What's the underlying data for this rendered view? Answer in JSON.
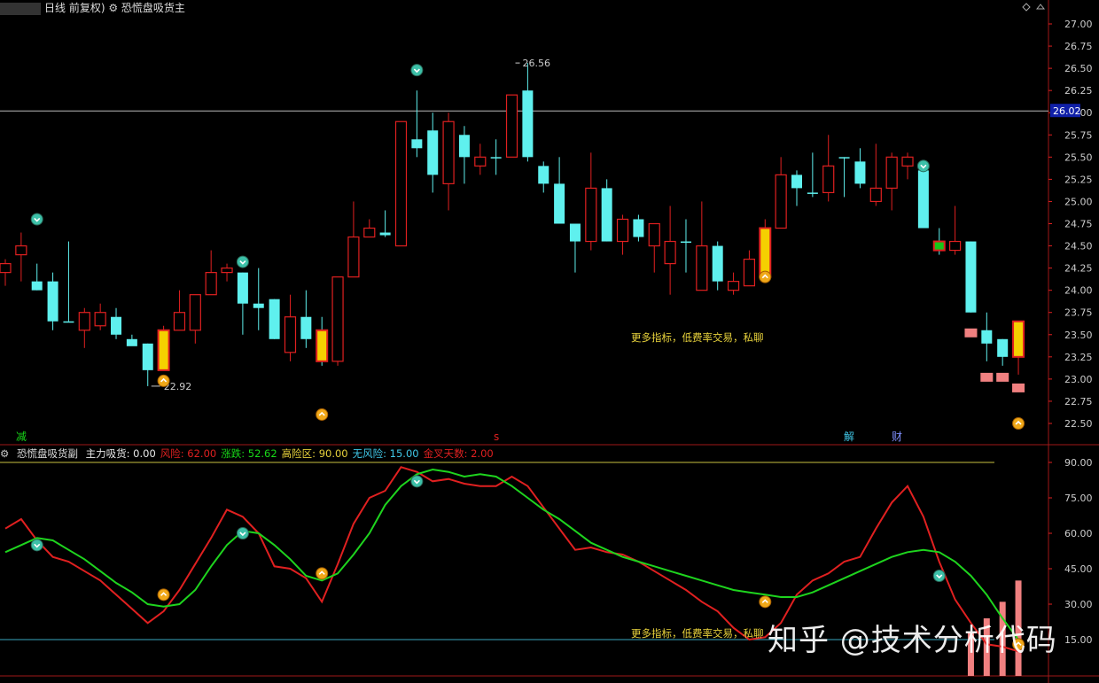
{
  "header": {
    "title_prefix": "日线 前复权)",
    "indicator_main": "恐慌盘吸货主",
    "current_price_badge": "26.02"
  },
  "subheader": {
    "indicator_sub": "恐慌盘吸货副",
    "fields": [
      {
        "label": "主力吸货:",
        "value": "0.00",
        "color": "#e8e8e8"
      },
      {
        "label": "风险:",
        "value": "62.00",
        "color": "#e02020"
      },
      {
        "label": "涨跌:",
        "value": "52.62",
        "color": "#18d818"
      },
      {
        "label": "高险区:",
        "value": "90.00",
        "color": "#e8d23c"
      },
      {
        "label": "无风险:",
        "value": "15.00",
        "color": "#40c8e8"
      },
      {
        "label": "金叉天数:",
        "value": "2.00",
        "color": "#e02020"
      }
    ]
  },
  "promo_text": "更多指标，低费率交易，私聊",
  "watermark": "知乎 @技术分析代码",
  "event_labels": [
    {
      "text": "减",
      "color": "#18d818"
    },
    {
      "text": "s",
      "color": "#e02020"
    },
    {
      "text": "解",
      "color": "#40c8e8"
    },
    {
      "text": "财",
      "color": "#8090ff"
    }
  ],
  "chart_data": [
    {
      "type": "candlestick",
      "title": "",
      "ylim": [
        22.35,
        27.1
      ],
      "y_ticks": [
        "27.00",
        "26.75",
        "26.50",
        "26.25",
        "26.00",
        "25.75",
        "25.50",
        "25.25",
        "25.00",
        "24.75",
        "24.50",
        "24.25",
        "24.00",
        "23.75",
        "23.50",
        "23.25",
        "23.00",
        "22.75",
        "22.50"
      ],
      "high_label": "26.56",
      "low_label": "22.92",
      "reference_line": 26.02,
      "candles": [
        [
          24.2,
          24.3,
          24.35,
          24.05
        ],
        [
          24.4,
          24.5,
          24.65,
          24.1
        ],
        [
          24.1,
          24.0,
          24.3,
          24.0
        ],
        [
          24.1,
          23.65,
          24.2,
          23.55
        ],
        [
          23.65,
          23.65,
          24.55,
          23.65
        ],
        [
          23.55,
          23.75,
          23.8,
          23.35
        ],
        [
          23.6,
          23.75,
          23.85,
          23.55
        ],
        [
          23.7,
          23.5,
          23.8,
          23.45
        ],
        [
          23.45,
          23.37,
          23.5,
          23.4
        ],
        [
          23.4,
          23.1,
          23.4,
          22.92
        ],
        [
          23.1,
          23.55,
          23.6,
          23.1
        ],
        [
          23.55,
          23.75,
          24.0,
          23.55
        ],
        [
          23.55,
          23.95,
          23.95,
          23.4
        ],
        [
          23.95,
          24.2,
          24.45,
          23.95
        ],
        [
          24.2,
          24.25,
          24.3,
          24.1
        ],
        [
          24.2,
          23.85,
          24.2,
          23.5
        ],
        [
          23.85,
          23.8,
          24.25,
          23.55
        ],
        [
          23.9,
          23.45,
          23.9,
          23.45
        ],
        [
          23.3,
          23.7,
          23.95,
          23.2
        ],
        [
          23.7,
          23.45,
          24.0,
          23.35
        ],
        [
          23.55,
          23.2,
          23.7,
          23.15
        ],
        [
          23.2,
          24.15,
          24.15,
          23.15
        ],
        [
          24.15,
          24.6,
          25.0,
          24.15
        ],
        [
          24.6,
          24.7,
          24.8,
          24.6
        ],
        [
          24.65,
          24.62,
          24.9,
          24.6
        ],
        [
          24.5,
          25.9,
          25.9,
          24.5
        ],
        [
          25.7,
          25.6,
          26.25,
          25.5
        ],
        [
          25.8,
          25.3,
          26.0,
          25.1
        ],
        [
          25.2,
          25.9,
          26.0,
          24.9
        ],
        [
          25.75,
          25.5,
          25.85,
          25.2
        ],
        [
          25.4,
          25.5,
          25.65,
          25.3
        ],
        [
          25.5,
          25.5,
          25.7,
          25.3
        ],
        [
          25.5,
          26.2,
          26.2,
          25.5
        ],
        [
          26.25,
          25.5,
          26.56,
          25.45
        ],
        [
          25.4,
          25.2,
          25.45,
          25.1
        ],
        [
          25.2,
          24.75,
          25.5,
          24.75
        ],
        [
          24.75,
          24.55,
          24.75,
          24.2
        ],
        [
          24.55,
          25.15,
          25.55,
          24.45
        ],
        [
          25.15,
          24.55,
          25.25,
          24.55
        ],
        [
          24.55,
          24.8,
          24.85,
          24.4
        ],
        [
          24.8,
          24.6,
          24.85,
          24.55
        ],
        [
          24.5,
          24.75,
          24.75,
          24.2
        ],
        [
          24.3,
          24.55,
          24.95,
          23.95
        ],
        [
          24.55,
          24.55,
          24.8,
          24.2
        ],
        [
          24.0,
          24.5,
          25.0,
          24.0
        ],
        [
          24.5,
          24.1,
          24.55,
          24.0
        ],
        [
          24.0,
          24.1,
          24.2,
          23.95
        ],
        [
          24.05,
          24.35,
          24.45,
          24.05
        ],
        [
          24.15,
          24.7,
          24.8,
          24.15
        ],
        [
          24.7,
          25.3,
          25.5,
          24.7
        ],
        [
          25.3,
          25.15,
          25.35,
          24.95
        ],
        [
          25.1,
          25.1,
          25.55,
          25.05
        ],
        [
          25.1,
          25.4,
          25.75,
          25.0
        ],
        [
          25.5,
          25.5,
          25.5,
          25.05
        ],
        [
          25.45,
          25.2,
          25.6,
          25.15
        ],
        [
          25.0,
          25.15,
          25.65,
          24.95
        ],
        [
          25.15,
          25.5,
          25.55,
          24.9
        ],
        [
          25.4,
          25.5,
          25.55,
          25.25
        ],
        [
          25.35,
          24.7,
          25.35,
          24.7
        ],
        [
          24.55,
          24.45,
          24.7,
          24.4
        ],
        [
          24.45,
          24.55,
          24.95,
          24.4
        ],
        [
          24.55,
          23.75,
          24.55,
          23.75
        ],
        [
          23.55,
          23.4,
          23.75,
          23.2
        ],
        [
          23.45,
          23.25,
          23.45,
          23.15
        ],
        [
          23.25,
          23.65,
          23.65,
          23.05
        ]
      ],
      "yellow_bars": [
        10,
        20,
        48,
        64
      ],
      "green_bar": 59,
      "pink_blocks": [
        [
          61,
          23.52
        ],
        [
          62,
          23.02
        ],
        [
          63,
          23.02
        ],
        [
          64,
          22.9
        ]
      ],
      "markers_down_teal": [
        [
          2,
          24.8
        ],
        [
          15,
          24.32
        ],
        [
          26,
          26.48
        ],
        [
          58,
          25.4
        ]
      ],
      "markers_up_orange": [
        [
          10,
          22.98
        ],
        [
          20,
          22.6
        ],
        [
          48,
          24.15
        ],
        [
          64,
          22.5
        ]
      ]
    },
    {
      "type": "line",
      "title": "",
      "ylim": [
        11,
        95
      ],
      "y_ticks": [
        "90.00",
        "75.00",
        "60.00",
        "45.00",
        "30.00",
        "15.00"
      ],
      "reference_lines": [
        {
          "value": 90,
          "color": "#c8c040"
        },
        {
          "value": 15,
          "color": "#3aa8c0"
        }
      ],
      "series": [
        {
          "name": "风险",
          "color": "#e02020",
          "values": [
            62,
            66,
            57,
            50,
            48,
            44,
            40,
            34,
            28,
            22,
            27,
            36,
            47,
            58,
            70,
            67,
            60,
            46,
            45,
            41,
            31,
            47,
            64,
            75,
            78,
            88,
            86,
            82,
            83,
            81,
            80,
            80,
            84,
            80,
            71,
            62,
            53,
            54,
            52,
            51,
            48,
            44,
            40,
            36,
            31,
            27,
            20,
            15,
            16,
            22,
            34,
            40,
            43,
            48,
            50,
            62,
            73,
            80,
            67,
            48,
            32,
            22,
            13,
            12,
            10
          ]
        },
        {
          "name": "涨跌",
          "color": "#1ed41e",
          "values": [
            52,
            55,
            58,
            57,
            53,
            49,
            44,
            39,
            35,
            30,
            29,
            30,
            36,
            46,
            55,
            61,
            60,
            55,
            49,
            42,
            40,
            43,
            51,
            60,
            72,
            80,
            85,
            87,
            86,
            84,
            85,
            84,
            80,
            75,
            70,
            66,
            61,
            56,
            53,
            50,
            48,
            46,
            44,
            42,
            40,
            38,
            36,
            35,
            34,
            33,
            33,
            35,
            38,
            41,
            44,
            47,
            50,
            52,
            53,
            52,
            48,
            42,
            34,
            24,
            15
          ]
        }
      ],
      "bars": {
        "color": "#f08080",
        "values": [
          [
            61,
            18
          ],
          [
            62,
            24
          ],
          [
            63,
            31
          ],
          [
            64,
            40
          ]
        ]
      },
      "markers_down_teal": [
        [
          2,
          55
        ],
        [
          15,
          60
        ],
        [
          26,
          82
        ],
        [
          59,
          42
        ]
      ],
      "markers_up_orange": [
        [
          10,
          34
        ],
        [
          20,
          43
        ],
        [
          48,
          31
        ],
        [
          64,
          13
        ]
      ]
    }
  ]
}
